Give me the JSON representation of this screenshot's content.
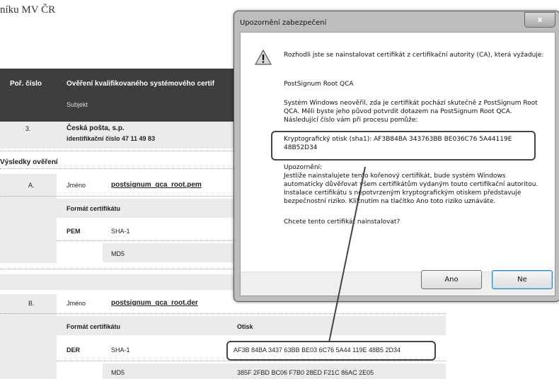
{
  "document": {
    "title": "níku MV ČR",
    "header": {
      "col_num": "Poř. číslo",
      "col_verify": "Ověření kvalifikovaného systémového certif",
      "col_subject": "Subjekt"
    },
    "entry": {
      "num": "3.",
      "name": "Česká pošta, s.p.",
      "id": "identifikační číslo 47 11 49 83"
    },
    "results_label": "Výsledky ověření",
    "a": {
      "letter": "A.",
      "name_label": "Jméno",
      "file": "postsignum_qca_root.pem",
      "format_label": "Formát certifikátu",
      "format": "PEM",
      "sha1_label": "SHA-1",
      "md5_label": "MD5"
    },
    "b": {
      "letter": "B.",
      "name_label": "Jméno",
      "file": "postsignum_qca_root.der",
      "format_label": "Formát certifikátu",
      "otisk_label": "Otisk",
      "format": "DER",
      "sha1_label": "SHA-1",
      "sha1_value": "AF3B 84BA 3437 63BB BE03 6C76 5A44 119E 48B5 2D34",
      "md5_label": "MD5",
      "md5_value": "385F 2FBD BC06 F7B0 28ED F21C 86AC 2E05"
    }
  },
  "dialog": {
    "title": "Upozornění zabezpečení",
    "close_label": "x",
    "icon": "warning-icon",
    "p1": "Rozhodli jste se nainstalovat certifikát z certifikační autority (CA), která vyžaduje:",
    "ca_name": "PostSignum Root QCA",
    "p2": "Systém Windows neověřil, zda je certifikát pochází skutečně z PostSignum Root QCA. Měli byste jeho původ potvrdit dotazem na PostSignum Root QCA. Následující číslo vám při procesu pomůže:",
    "thumbprint": "Kryptografický otisk (sha1): AF3B84BA 343763BB BE036C76 5A44119E 48B52D34",
    "warning_title": "Upozornění:",
    "warning_text": "Jestliže nainstalujete tento kořenový certifikát, bude systém Windows automaticky důvěřovat všem certifikátům vydaným touto certifikační autoritou. Instalace certifikátu s nepotvrzeným kryptografickým otiskem představuje bezpečnostní riziko. Kliknutím na tlačítko Ano toto riziko uznáváte.",
    "question": "Chcete tento certifikát nainstalovat?",
    "yes": "Ano",
    "no": "Ne"
  },
  "colors": {
    "header_bg": "#3e3e3e",
    "row_bg": "#ebebeb",
    "highlight": "#444444"
  }
}
